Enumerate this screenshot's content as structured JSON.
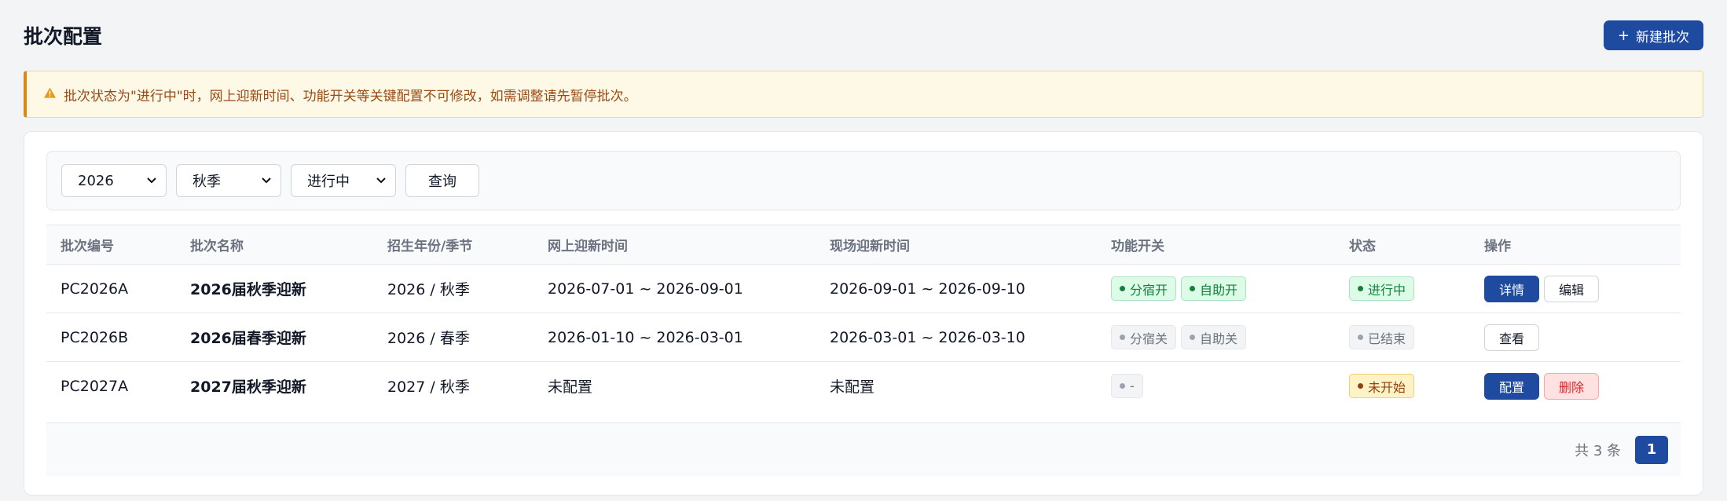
{
  "header": {
    "title": "批次配置",
    "new_button": "新建批次",
    "new_button_icon": "+"
  },
  "alert": {
    "icon": "warning-icon",
    "text": "批次状态为\"进行中\"时，网上迎新时间、功能开关等关键配置不可修改，如需调整请先暂停批次。"
  },
  "filters": {
    "year": "2026",
    "season": "秋季",
    "status": "进行中",
    "query_button": "查询"
  },
  "table": {
    "columns": [
      "批次编号",
      "批次名称",
      "招生年份/季节",
      "网上迎新时间",
      "现场迎新时间",
      "功能开关",
      "状态",
      "操作"
    ],
    "rows": [
      {
        "id": "PC2026A",
        "name": "2026届秋季迎新",
        "year_season": "2026 / 秋季",
        "online_time": "2026-07-01 ~ 2026-09-01",
        "onsite_time": "2026-09-01 ~ 2026-09-10",
        "switches": [
          "分宿开",
          "自助开"
        ],
        "status": "进行中",
        "actions": [
          "详情",
          "编辑"
        ]
      },
      {
        "id": "PC2026B",
        "name": "2026届春季迎新",
        "year_season": "2026 / 春季",
        "online_time": "2026-01-10 ~ 2026-03-01",
        "onsite_time": "2026-03-01 ~ 2026-03-10",
        "switches": [
          "分宿关",
          "自助关"
        ],
        "status": "已结束",
        "actions": [
          "查看"
        ]
      },
      {
        "id": "PC2027A",
        "name": "2027届秋季迎新",
        "year_season": "2027 / 秋季",
        "online_time": "未配置",
        "onsite_time": "未配置",
        "switches": [
          "-"
        ],
        "status": "未开始",
        "actions": [
          "配置",
          "删除"
        ]
      }
    ]
  },
  "pagination": {
    "total": "共 3 条",
    "current_page": "1"
  },
  "colors": {
    "primary": "#1e4aa0",
    "success": "#15803d",
    "warning": "#92400e",
    "danger": "#dc2626"
  }
}
